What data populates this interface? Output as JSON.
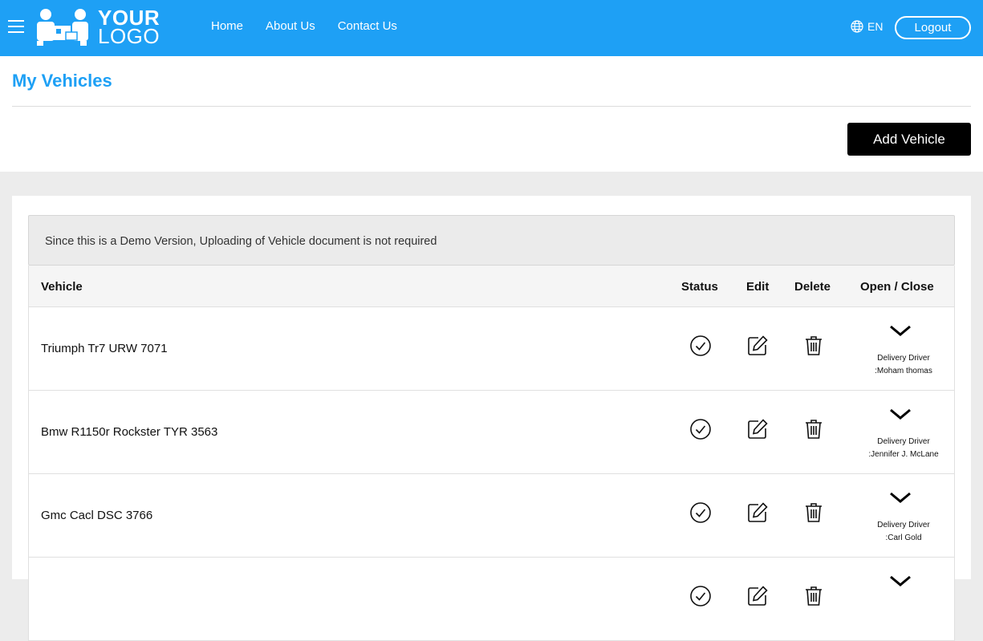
{
  "header": {
    "logo": {
      "line1": "YOUR",
      "line2": "LOGO"
    },
    "nav": [
      "Home",
      "About Us",
      "Contact Us"
    ],
    "language": "EN",
    "logout_label": "Logout"
  },
  "page": {
    "title": "My Vehicles",
    "add_button_label": "Add Vehicle"
  },
  "notice": "Since this is a Demo Version, Uploading of Vehicle document is not required",
  "table": {
    "columns": [
      "Vehicle",
      "Status",
      "Edit",
      "Delete",
      "Open / Close"
    ],
    "rows": [
      {
        "vehicle": "Triumph Tr7 URW 7071",
        "driver_label": "Delivery Driver",
        "driver_name": ":Moham thomas"
      },
      {
        "vehicle": "Bmw R1150r Rockster TYR 3563",
        "driver_label": "Delivery Driver",
        "driver_name": ":Jennifer J. McLane"
      },
      {
        "vehicle": "Gmc Cacl DSC 3766",
        "driver_label": "Delivery Driver",
        "driver_name": ":Carl Gold"
      },
      {
        "vehicle": "",
        "driver_label": "",
        "driver_name": ""
      }
    ]
  },
  "icons": {
    "status": "check-circle-icon",
    "edit": "edit-icon",
    "delete": "trash-icon",
    "toggle": "chevron-down-icon"
  },
  "colors": {
    "primary": "#1ea0f5",
    "button": "#000000"
  }
}
